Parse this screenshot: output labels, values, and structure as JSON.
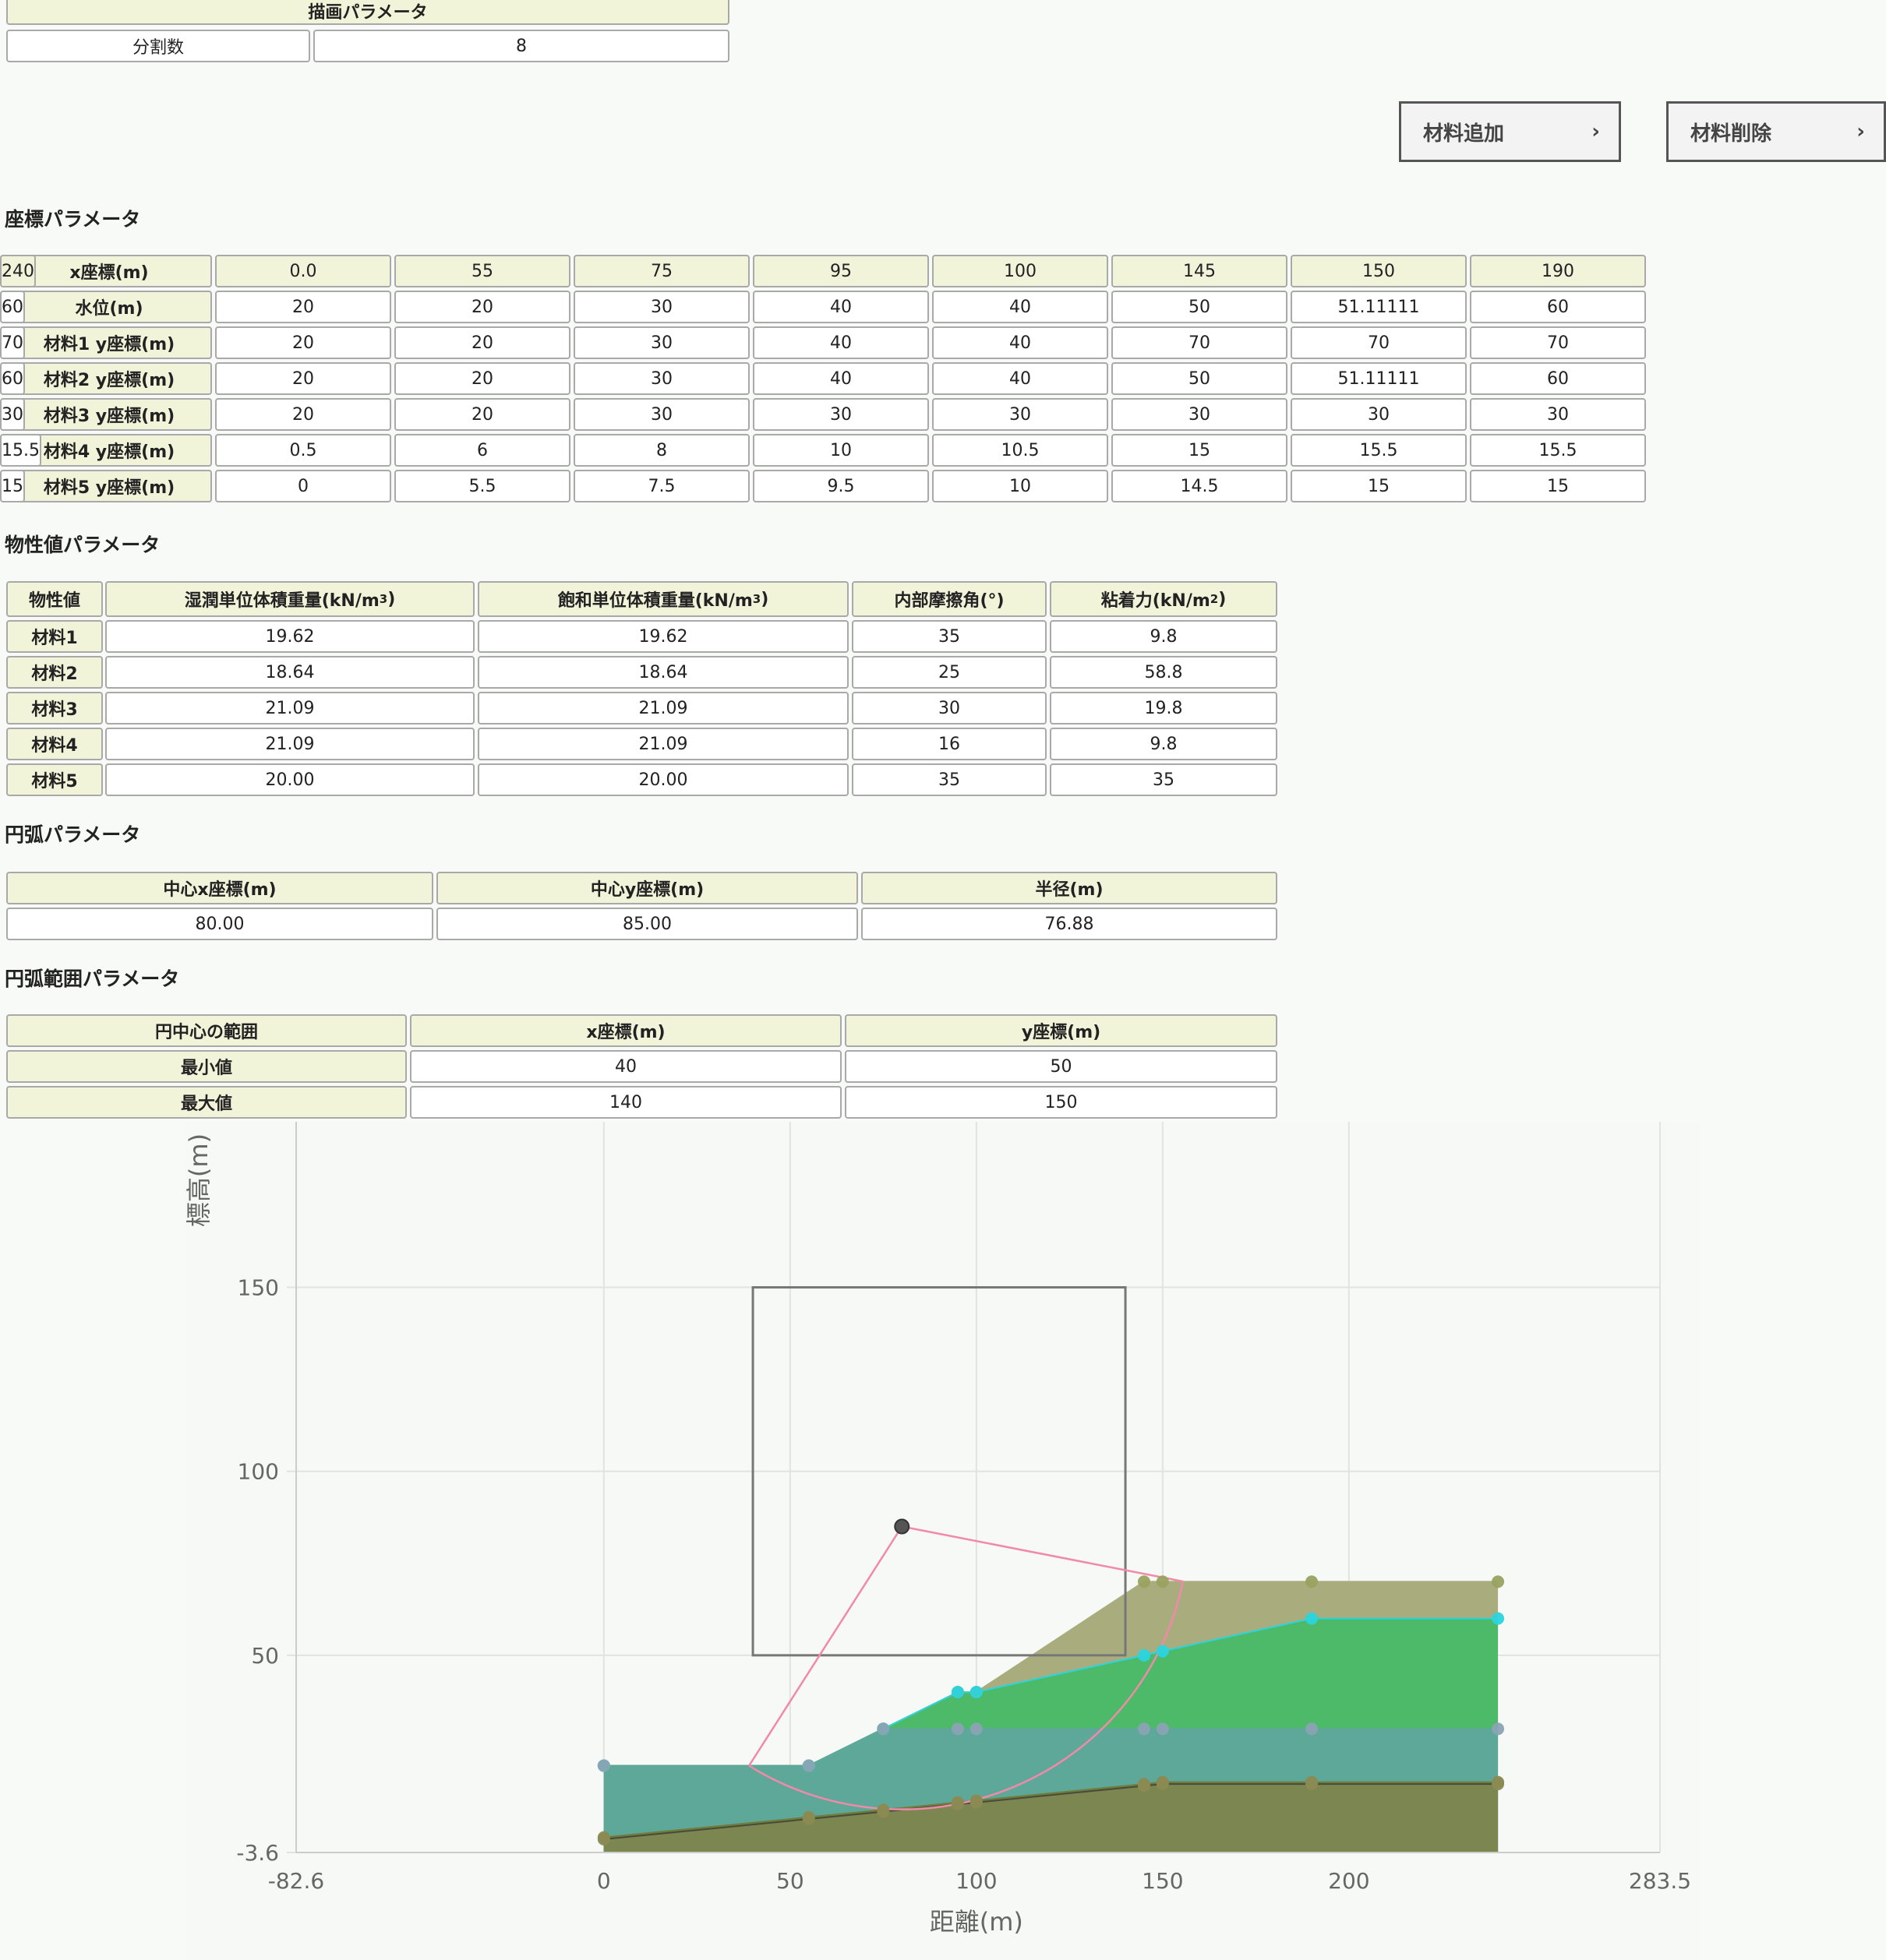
{
  "draw_params": {
    "header": "描画パラメータ",
    "label": "分割数",
    "value": "8"
  },
  "buttons": {
    "add_material": "材料追加",
    "delete_material": "材料削除",
    "chevron": "›"
  },
  "coord_section": {
    "title": "座標パラメータ",
    "rows": [
      {
        "label": "x座標(m)",
        "values": [
          "0.0",
          "55",
          "75",
          "95",
          "100",
          "145",
          "150",
          "190",
          "240"
        ]
      },
      {
        "label": "水位(m)",
        "values": [
          "20",
          "20",
          "30",
          "40",
          "40",
          "50",
          "51.11111",
          "60",
          "60"
        ]
      },
      {
        "label": "材料1 y座標(m)",
        "values": [
          "20",
          "20",
          "30",
          "40",
          "40",
          "70",
          "70",
          "70",
          "70"
        ]
      },
      {
        "label": "材料2 y座標(m)",
        "values": [
          "20",
          "20",
          "30",
          "40",
          "40",
          "50",
          "51.11111",
          "60",
          "60"
        ]
      },
      {
        "label": "材料3 y座標(m)",
        "values": [
          "20",
          "20",
          "30",
          "30",
          "30",
          "30",
          "30",
          "30",
          "30"
        ]
      },
      {
        "label": "材料4 y座標(m)",
        "values": [
          "0.5",
          "6",
          "8",
          "10",
          "10.5",
          "15",
          "15.5",
          "15.5",
          "15.5"
        ]
      },
      {
        "label": "材料5 y座標(m)",
        "values": [
          "0",
          "5.5",
          "7.5",
          "9.5",
          "10",
          "14.5",
          "15",
          "15",
          "15"
        ]
      }
    ]
  },
  "prop_section": {
    "title": "物性値パラメータ",
    "headers": {
      "h0": "物性値",
      "h1": "湿潤単位体積重量(kN/m",
      "h1_sup": "3",
      "h1_end": ")",
      "h2": "飽和単位体積重量(kN/m",
      "h2_sup": "3",
      "h2_end": ")",
      "h3": "内部摩擦角(°)",
      "h4": "粘着力(kN/m",
      "h4_sup": "2",
      "h4_end": ")"
    },
    "rows": [
      {
        "label": "材料1",
        "values": [
          "19.62",
          "19.62",
          "35",
          "9.8"
        ]
      },
      {
        "label": "材料2",
        "values": [
          "18.64",
          "18.64",
          "25",
          "58.8"
        ]
      },
      {
        "label": "材料3",
        "values": [
          "21.09",
          "21.09",
          "30",
          "19.8"
        ]
      },
      {
        "label": "材料4",
        "values": [
          "21.09",
          "21.09",
          "16",
          "9.8"
        ]
      },
      {
        "label": "材料5",
        "values": [
          "20.00",
          "20.00",
          "35",
          "35"
        ]
      }
    ]
  },
  "arc_section": {
    "title": "円弧パラメータ",
    "headers": [
      "中心x座標(m)",
      "中心y座標(m)",
      "半径(m)"
    ],
    "values": [
      "80.00",
      "85.00",
      "76.88"
    ]
  },
  "range_section": {
    "title": "円弧範囲パラメータ",
    "headers": [
      "円中心の範囲",
      "x座標(m)",
      "y座標(m)"
    ],
    "rows": [
      {
        "label": "最小値",
        "values": [
          "40",
          "50"
        ]
      },
      {
        "label": "最大値",
        "values": [
          "140",
          "150"
        ]
      }
    ]
  },
  "chart_data": {
    "type": "area",
    "xlabel": "距離(m)",
    "ylabel": "標高(m)",
    "xlim": [
      -82.6,
      283.5
    ],
    "ylim": [
      -3.6,
      195
    ],
    "x_ticks": [
      "-82.6",
      "0",
      "50",
      "100",
      "150",
      "200",
      "283.5"
    ],
    "y_ticks": [
      "-3.6",
      "50",
      "100",
      "150"
    ],
    "x": [
      0,
      55,
      75,
      95,
      100,
      145,
      150,
      190,
      240
    ],
    "series": [
      {
        "values": [
          20,
          20,
          30,
          40,
          40,
          70,
          70,
          70,
          70
        ],
        "color": "#a9ad7e"
      },
      {
        "values": [
          20,
          20,
          30,
          40,
          40,
          50,
          51.11111,
          60,
          60
        ],
        "color": "#4cba68"
      },
      {
        "values": [
          20,
          20,
          30,
          30,
          30,
          30,
          30,
          30,
          30
        ],
        "color": "#5ea899"
      },
      {
        "values": [
          0.5,
          6,
          8,
          10,
          10.5,
          15,
          15.5,
          15.5,
          15.5
        ],
        "color": "#6f7d3c"
      },
      {
        "values": [
          0,
          5.5,
          7.5,
          9.5,
          10,
          14.5,
          15,
          15,
          15
        ],
        "color": "#7c8650"
      }
    ],
    "water_level": [
      20,
      20,
      30,
      40,
      40,
      50,
      51.11111,
      60,
      60
    ],
    "arc": {
      "cx": 80,
      "cy": 85,
      "r": 76.88,
      "color": "#f08aa8"
    },
    "search_range": {
      "xmin": 40,
      "xmax": 140,
      "ymin": 50,
      "ymax": 150
    },
    "grid": true,
    "colors": {
      "water_marker": "#2bd4dd",
      "material_marker": "#9aa260",
      "grid": "#e2e2e2"
    }
  }
}
